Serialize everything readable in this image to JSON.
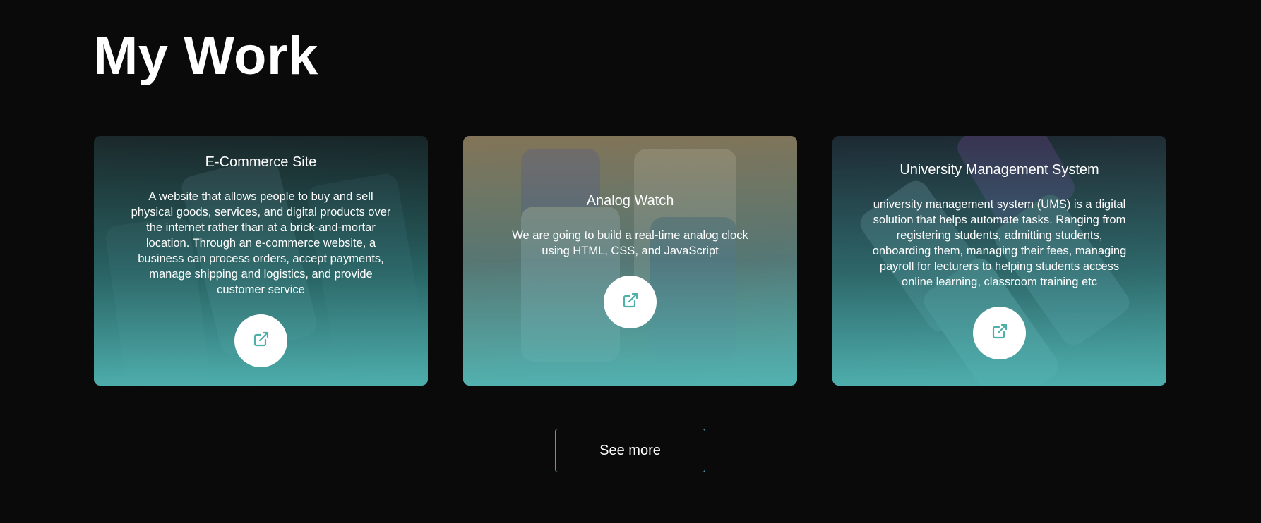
{
  "section": {
    "title": "My Work"
  },
  "projects": [
    {
      "title": "E-Commerce Site",
      "description": "A website that allows people to buy and sell physical goods, services, and digital products over the internet rather than at a brick-and-mortar location. Through an e-commerce website, a business can process orders, accept payments, manage shipping and logistics, and provide customer service",
      "link_icon": "external-link-icon"
    },
    {
      "title": "Analog Watch",
      "description": "We are going to build a real-time analog clock using HTML, CSS, and JavaScript",
      "link_icon": "external-link-icon"
    },
    {
      "title": "University Management System",
      "description": "university management system (UMS) is a digital solution that helps automate tasks. Ranging from registering students, admitting students, onboarding them, managing their fees, managing payroll for lecturers to helping students access online learning, classroom training etc",
      "link_icon": "external-link-icon"
    }
  ],
  "see_more": {
    "label": "See more"
  },
  "colors": {
    "background": "#0a0a0a",
    "accent": "#52b4b2",
    "button_border": "#4f9ea8",
    "icon": "#4fb0aa"
  }
}
